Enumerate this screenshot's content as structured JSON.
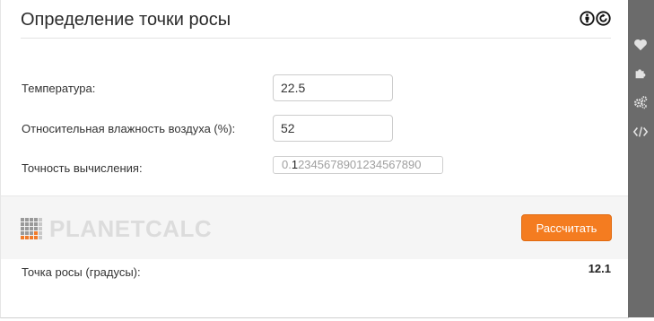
{
  "header": {
    "title": "Определение точки росы",
    "license_icons": [
      "cc-by-icon",
      "cc-sa-icon"
    ]
  },
  "form": {
    "temperature": {
      "label": "Температура:",
      "value": "22.5"
    },
    "humidity": {
      "label": "Относительная влажность воздуха (%):",
      "value": "52"
    },
    "precision": {
      "label": "Точность вычисления:",
      "prefix": "0.",
      "selected_digit": "1",
      "rest_digits": "2345678901234567890"
    }
  },
  "footer_band": {
    "logo_text": "PLANETCALC",
    "calculate_label": "Рассчитать"
  },
  "result": {
    "label": "Точка росы (градусы):",
    "value": "12.1"
  },
  "sidebar": {
    "icons": [
      "heart-icon",
      "puzzle-icon",
      "gears-icon",
      "code-icon"
    ]
  },
  "colors": {
    "accent": "#f47c20",
    "sidebar": "#6b6b6b",
    "band": "#f5f5f5"
  }
}
